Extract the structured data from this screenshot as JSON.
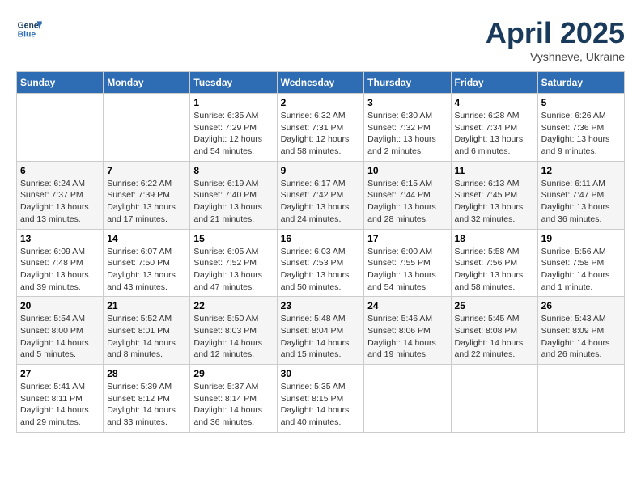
{
  "header": {
    "logo_line1": "General",
    "logo_line2": "Blue",
    "month_title": "April 2025",
    "location": "Vyshneve, Ukraine"
  },
  "weekdays": [
    "Sunday",
    "Monday",
    "Tuesday",
    "Wednesday",
    "Thursday",
    "Friday",
    "Saturday"
  ],
  "weeks": [
    [
      {
        "day": "",
        "sunrise": "",
        "sunset": "",
        "daylight": ""
      },
      {
        "day": "",
        "sunrise": "",
        "sunset": "",
        "daylight": ""
      },
      {
        "day": "1",
        "sunrise": "Sunrise: 6:35 AM",
        "sunset": "Sunset: 7:29 PM",
        "daylight": "Daylight: 12 hours and 54 minutes."
      },
      {
        "day": "2",
        "sunrise": "Sunrise: 6:32 AM",
        "sunset": "Sunset: 7:31 PM",
        "daylight": "Daylight: 12 hours and 58 minutes."
      },
      {
        "day": "3",
        "sunrise": "Sunrise: 6:30 AM",
        "sunset": "Sunset: 7:32 PM",
        "daylight": "Daylight: 13 hours and 2 minutes."
      },
      {
        "day": "4",
        "sunrise": "Sunrise: 6:28 AM",
        "sunset": "Sunset: 7:34 PM",
        "daylight": "Daylight: 13 hours and 6 minutes."
      },
      {
        "day": "5",
        "sunrise": "Sunrise: 6:26 AM",
        "sunset": "Sunset: 7:36 PM",
        "daylight": "Daylight: 13 hours and 9 minutes."
      }
    ],
    [
      {
        "day": "6",
        "sunrise": "Sunrise: 6:24 AM",
        "sunset": "Sunset: 7:37 PM",
        "daylight": "Daylight: 13 hours and 13 minutes."
      },
      {
        "day": "7",
        "sunrise": "Sunrise: 6:22 AM",
        "sunset": "Sunset: 7:39 PM",
        "daylight": "Daylight: 13 hours and 17 minutes."
      },
      {
        "day": "8",
        "sunrise": "Sunrise: 6:19 AM",
        "sunset": "Sunset: 7:40 PM",
        "daylight": "Daylight: 13 hours and 21 minutes."
      },
      {
        "day": "9",
        "sunrise": "Sunrise: 6:17 AM",
        "sunset": "Sunset: 7:42 PM",
        "daylight": "Daylight: 13 hours and 24 minutes."
      },
      {
        "day": "10",
        "sunrise": "Sunrise: 6:15 AM",
        "sunset": "Sunset: 7:44 PM",
        "daylight": "Daylight: 13 hours and 28 minutes."
      },
      {
        "day": "11",
        "sunrise": "Sunrise: 6:13 AM",
        "sunset": "Sunset: 7:45 PM",
        "daylight": "Daylight: 13 hours and 32 minutes."
      },
      {
        "day": "12",
        "sunrise": "Sunrise: 6:11 AM",
        "sunset": "Sunset: 7:47 PM",
        "daylight": "Daylight: 13 hours and 36 minutes."
      }
    ],
    [
      {
        "day": "13",
        "sunrise": "Sunrise: 6:09 AM",
        "sunset": "Sunset: 7:48 PM",
        "daylight": "Daylight: 13 hours and 39 minutes."
      },
      {
        "day": "14",
        "sunrise": "Sunrise: 6:07 AM",
        "sunset": "Sunset: 7:50 PM",
        "daylight": "Daylight: 13 hours and 43 minutes."
      },
      {
        "day": "15",
        "sunrise": "Sunrise: 6:05 AM",
        "sunset": "Sunset: 7:52 PM",
        "daylight": "Daylight: 13 hours and 47 minutes."
      },
      {
        "day": "16",
        "sunrise": "Sunrise: 6:03 AM",
        "sunset": "Sunset: 7:53 PM",
        "daylight": "Daylight: 13 hours and 50 minutes."
      },
      {
        "day": "17",
        "sunrise": "Sunrise: 6:00 AM",
        "sunset": "Sunset: 7:55 PM",
        "daylight": "Daylight: 13 hours and 54 minutes."
      },
      {
        "day": "18",
        "sunrise": "Sunrise: 5:58 AM",
        "sunset": "Sunset: 7:56 PM",
        "daylight": "Daylight: 13 hours and 58 minutes."
      },
      {
        "day": "19",
        "sunrise": "Sunrise: 5:56 AM",
        "sunset": "Sunset: 7:58 PM",
        "daylight": "Daylight: 14 hours and 1 minute."
      }
    ],
    [
      {
        "day": "20",
        "sunrise": "Sunrise: 5:54 AM",
        "sunset": "Sunset: 8:00 PM",
        "daylight": "Daylight: 14 hours and 5 minutes."
      },
      {
        "day": "21",
        "sunrise": "Sunrise: 5:52 AM",
        "sunset": "Sunset: 8:01 PM",
        "daylight": "Daylight: 14 hours and 8 minutes."
      },
      {
        "day": "22",
        "sunrise": "Sunrise: 5:50 AM",
        "sunset": "Sunset: 8:03 PM",
        "daylight": "Daylight: 14 hours and 12 minutes."
      },
      {
        "day": "23",
        "sunrise": "Sunrise: 5:48 AM",
        "sunset": "Sunset: 8:04 PM",
        "daylight": "Daylight: 14 hours and 15 minutes."
      },
      {
        "day": "24",
        "sunrise": "Sunrise: 5:46 AM",
        "sunset": "Sunset: 8:06 PM",
        "daylight": "Daylight: 14 hours and 19 minutes."
      },
      {
        "day": "25",
        "sunrise": "Sunrise: 5:45 AM",
        "sunset": "Sunset: 8:08 PM",
        "daylight": "Daylight: 14 hours and 22 minutes."
      },
      {
        "day": "26",
        "sunrise": "Sunrise: 5:43 AM",
        "sunset": "Sunset: 8:09 PM",
        "daylight": "Daylight: 14 hours and 26 minutes."
      }
    ],
    [
      {
        "day": "27",
        "sunrise": "Sunrise: 5:41 AM",
        "sunset": "Sunset: 8:11 PM",
        "daylight": "Daylight: 14 hours and 29 minutes."
      },
      {
        "day": "28",
        "sunrise": "Sunrise: 5:39 AM",
        "sunset": "Sunset: 8:12 PM",
        "daylight": "Daylight: 14 hours and 33 minutes."
      },
      {
        "day": "29",
        "sunrise": "Sunrise: 5:37 AM",
        "sunset": "Sunset: 8:14 PM",
        "daylight": "Daylight: 14 hours and 36 minutes."
      },
      {
        "day": "30",
        "sunrise": "Sunrise: 5:35 AM",
        "sunset": "Sunset: 8:15 PM",
        "daylight": "Daylight: 14 hours and 40 minutes."
      },
      {
        "day": "",
        "sunrise": "",
        "sunset": "",
        "daylight": ""
      },
      {
        "day": "",
        "sunrise": "",
        "sunset": "",
        "daylight": ""
      },
      {
        "day": "",
        "sunrise": "",
        "sunset": "",
        "daylight": ""
      }
    ]
  ]
}
